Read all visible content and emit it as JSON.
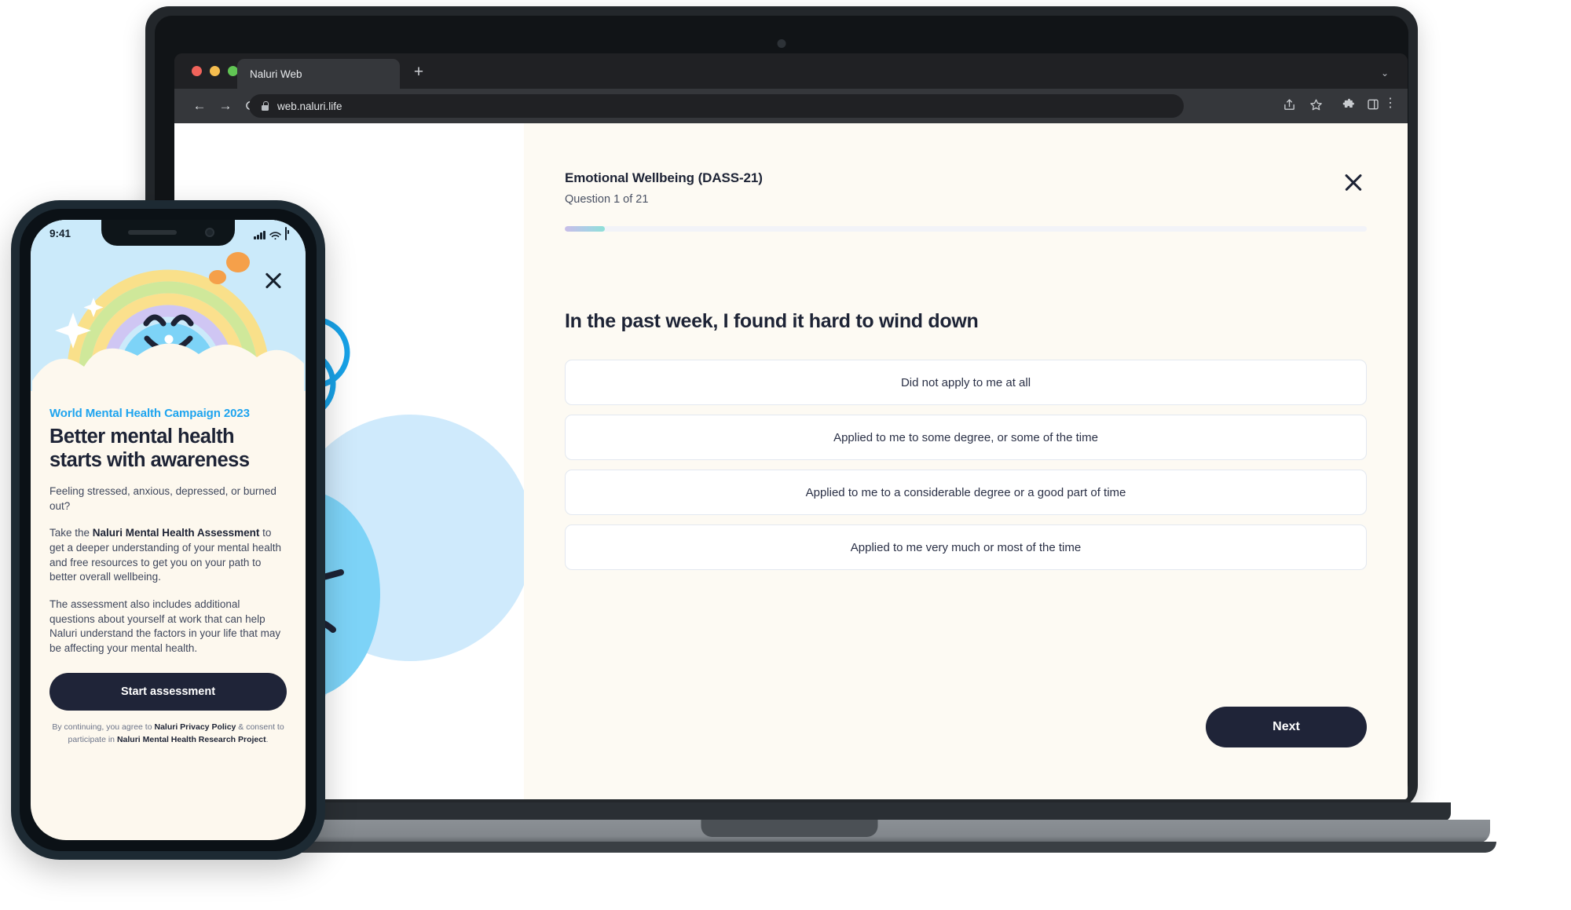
{
  "browser": {
    "tab_title": "Naluri Web",
    "new_tab_label": "+",
    "tab_list_chevron": "⌄",
    "back_icon": "←",
    "forward_icon": "→",
    "reload_icon": "⟳",
    "url": "web.naluri.life",
    "toolbar_icons": [
      "share-icon",
      "bookmark-star-icon",
      "extensions-puzzle-icon",
      "side-panel-icon",
      "overflow-menu-icon"
    ]
  },
  "assessment": {
    "title": "Emotional Wellbeing (DASS-21)",
    "subtitle": "Question 1 of 21",
    "progress_percent": 5,
    "question": "In the past week, I found it hard to wind down",
    "options": [
      "Did not apply to me at all",
      "Applied to me to some degree, or some of the time",
      "Applied to me to a considerable degree or a good part of time",
      "Applied to me very much or most of the time"
    ],
    "next_label": "Next",
    "close_label": "Close"
  },
  "phone": {
    "status": {
      "time": "9:41",
      "signal": "signal-bars-icon",
      "wifi": "wifi-icon",
      "battery": "battery-icon"
    },
    "close_label": "Close",
    "eyebrow": "World Mental Health Campaign 2023",
    "headline_line1": "Better mental health",
    "headline_line2": "starts with awareness",
    "para1": "Feeling stressed, anxious, depressed, or burned out?",
    "para2_before": "Take the ",
    "para2_bold": "Naluri Mental Health Assessment",
    "para2_after": " to get a deeper understanding of your mental health and free resources to get you on your path to better overall wellbeing.",
    "para3": "The assessment also includes additional questions about yourself at work that can help Naluri understand the factors in your life that may be affecting your mental health.",
    "cta_label": "Start assessment",
    "legal_1": "By continuing, you agree to ",
    "legal_link1": "Naluri Privacy Policy",
    "legal_2": " & consent to participate in ",
    "legal_link2": "Naluri Mental Health Research Project",
    "legal_3": "."
  },
  "colors": {
    "brand_blue": "#1ea4ef",
    "ink": "#1d2335",
    "cream": "#fdfaf3",
    "phone_cream": "#fdf8ee",
    "sky": "#cbeafa",
    "blob_blue": "#7dd3f7",
    "pale_blue": "#cfeafc",
    "orange": "#f5a04a",
    "progress_start": "#c9bde8",
    "progress_end": "#8ee0d7"
  }
}
